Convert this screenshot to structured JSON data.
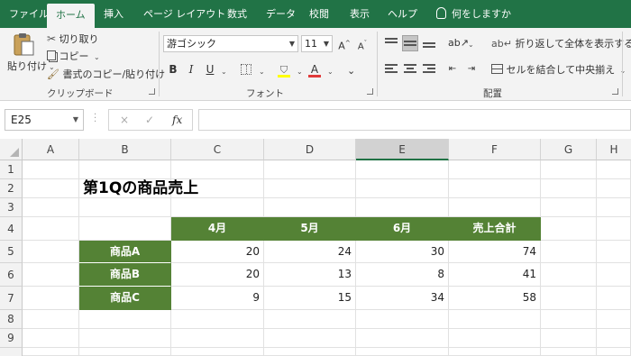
{
  "ribbon_tabs": [
    {
      "label": "ファイル"
    },
    {
      "label": "ホーム"
    },
    {
      "label": "挿入"
    },
    {
      "label": "ページ レイアウト"
    },
    {
      "label": "数式"
    },
    {
      "label": "データ"
    },
    {
      "label": "校閲"
    },
    {
      "label": "表示"
    },
    {
      "label": "ヘルプ"
    },
    {
      "label": "何をしますか"
    }
  ],
  "active_tab": "ホーム",
  "clipboard": {
    "paste": "貼り付け",
    "cut": "切り取り",
    "copy": "コピー",
    "format_painter": "書式のコピー/貼り付け",
    "group_label": "クリップボード"
  },
  "font": {
    "name": "游ゴシック",
    "size": "11",
    "bold": "B",
    "italic": "I",
    "underline": "U",
    "group_label": "フォント"
  },
  "alignment": {
    "wrap_text": "折り返して全体を表示する",
    "merge_center": "セルを結合して中央揃え",
    "group_label": "配置"
  },
  "formula_bar": {
    "name_box": "E25",
    "cancel_icon": "×",
    "enter_icon": "✓",
    "fx_label": "fx",
    "formula": ""
  },
  "columns": [
    "A",
    "B",
    "C",
    "D",
    "E",
    "F",
    "G",
    "H"
  ],
  "selected_column": "E",
  "rows": [
    "1",
    "2",
    "3",
    "4",
    "5",
    "6",
    "7",
    "8",
    "9"
  ],
  "sheet": {
    "title": "第1Qの商品売上",
    "headers": [
      "4月",
      "5月",
      "6月",
      "売上合計"
    ],
    "products": [
      {
        "name": "商品A",
        "values": [
          "20",
          "24",
          "30",
          "74"
        ]
      },
      {
        "name": "商品B",
        "values": [
          "20",
          "13",
          "8",
          "41"
        ]
      },
      {
        "name": "商品C",
        "values": [
          "9",
          "15",
          "34",
          "58"
        ]
      }
    ]
  },
  "colors": {
    "excel_green": "#217346",
    "table_green": "#548235"
  }
}
